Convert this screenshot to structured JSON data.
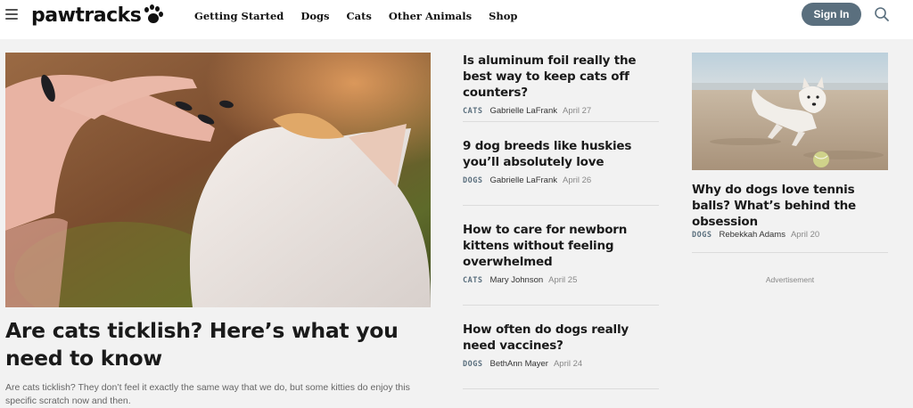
{
  "header": {
    "logo_text": "pawtracks",
    "nav": [
      "Getting Started",
      "Dogs",
      "Cats",
      "Other Animals",
      "Shop"
    ],
    "signin_label": "Sign In"
  },
  "hero": {
    "title": "Are cats ticklish? Here’s what you need to know",
    "description": "Are cats ticklish? They don’t feel it exactly the same way that we do, but some kitties do enjoy this specific scratch now and then."
  },
  "articles": [
    {
      "title": "Is aluminum foil really the best way to keep cats off counters?",
      "category": "CATS",
      "author": "Gabrielle LaFrank",
      "date": "April 27"
    },
    {
      "title": "9 dog breeds like huskies you’ll absolutely love",
      "category": "DOGS",
      "author": "Gabrielle LaFrank",
      "date": "April 26"
    },
    {
      "title": "How to care for newborn kittens without feeling overwhelmed",
      "category": "CATS",
      "author": "Mary Johnson",
      "date": "April 25"
    },
    {
      "title": "How often do dogs really need vaccines?",
      "category": "DOGS",
      "author": "BethAnn Mayer",
      "date": "April 24"
    }
  ],
  "side_article": {
    "title": "Why do dogs love tennis balls? What’s behind the obsession",
    "category": "DOGS",
    "author": "Rebekkah Adams",
    "date": "April 20"
  },
  "advertisement_label": "Advertisement",
  "colors": {
    "accent": "#5a6f7e",
    "page_bg": "#f2f2f2",
    "header_bg": "#ffffff"
  }
}
